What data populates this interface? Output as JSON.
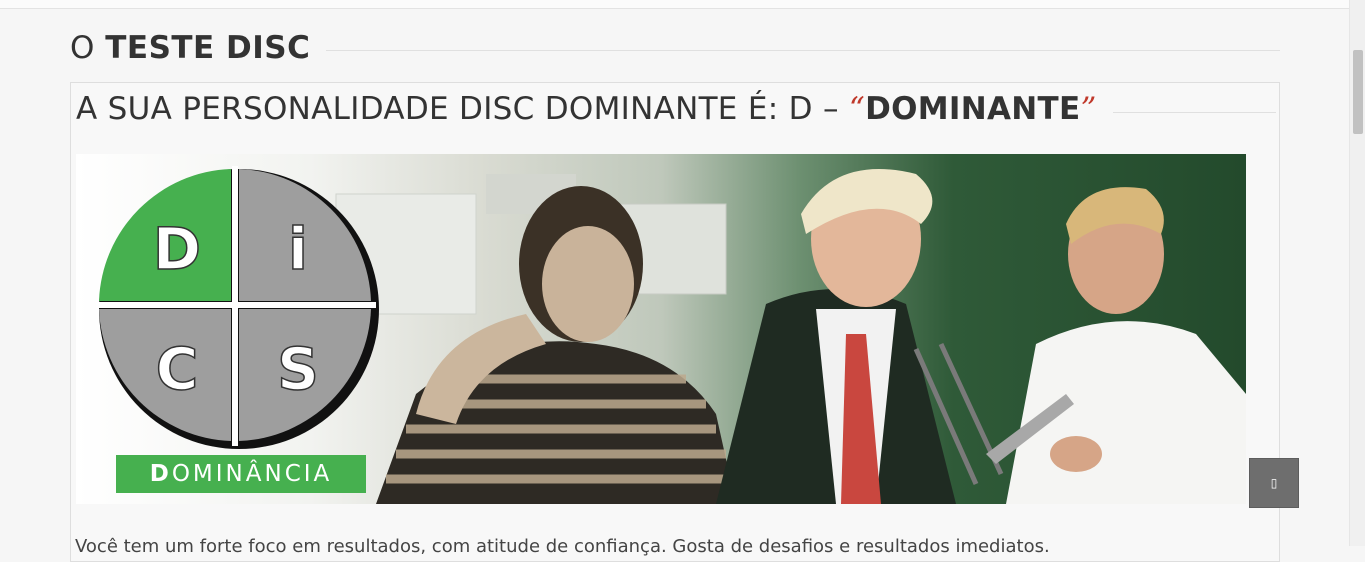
{
  "page": {
    "section_title_prefix": "O",
    "section_title_bold": "TESTE DISC"
  },
  "result": {
    "heading_prefix": "A SUA PERSONALIDADE DISC DOMINANTE É: D –",
    "quote_open": "“",
    "dominant_word": "DOMINANTE",
    "quote_close": "”",
    "quote_color": "#c0392b"
  },
  "banner": {
    "quadrants": [
      {
        "letter": "D",
        "color": "#46b04f",
        "active": true
      },
      {
        "letter": "i",
        "color": "#9e9e9e",
        "active": false
      },
      {
        "letter": "C",
        "color": "#9e9e9e",
        "active": false
      },
      {
        "letter": "S",
        "color": "#9e9e9e",
        "active": false
      }
    ],
    "label_first": "D",
    "label_rest": "OMINÂNCIA",
    "label_color": "#46b04f"
  },
  "body": {
    "partial_text": "Você tem um forte foco em resultados, com atitude de confiança. Gosta de desafios e resultados imediatos."
  },
  "controls": {
    "back_to_top_glyph": "▯"
  }
}
